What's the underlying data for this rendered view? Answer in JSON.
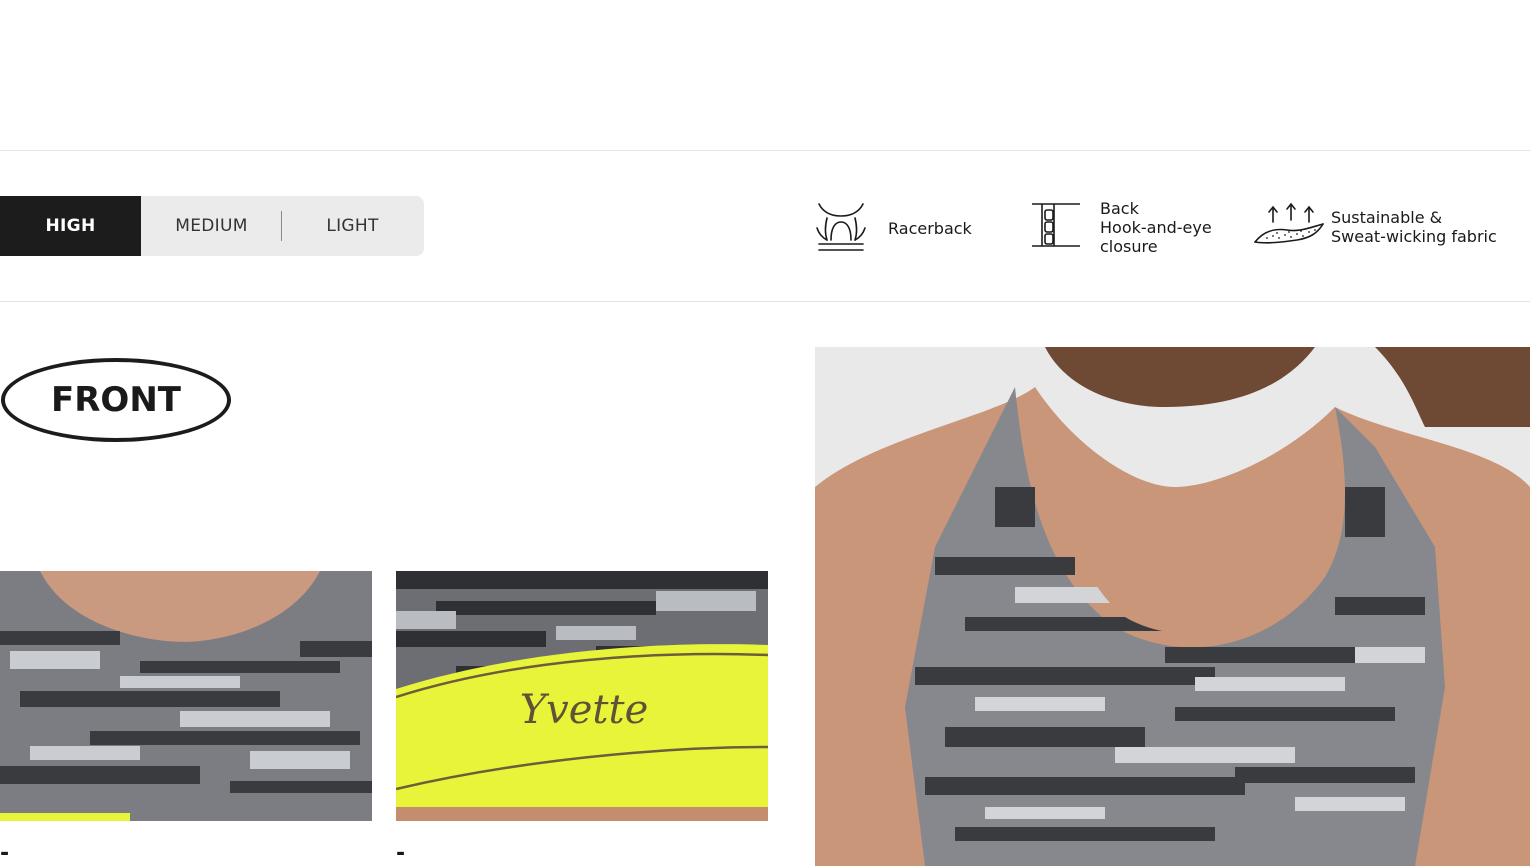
{
  "support_levels": {
    "options": [
      "HIGH",
      "MEDIUM",
      "LIGHT"
    ],
    "selected": "HIGH"
  },
  "features": [
    {
      "icon": "racerback-icon",
      "lines": [
        "Racerback"
      ]
    },
    {
      "icon": "hook-and-eye-icon",
      "lines": [
        "Back",
        "Hook-and-eye",
        "closure"
      ]
    },
    {
      "icon": "sweat-wicking-fabric-icon",
      "lines": [
        "Sustainable &",
        "Sweat-wicking fabric"
      ]
    }
  ],
  "view_badge": "FRONT",
  "gallery": {
    "captions": [
      "-",
      "-"
    ],
    "brand_band_text": "Yvette",
    "band_color": "#e8f43a"
  },
  "colors": {
    "active_bg": "#1c1c1c",
    "control_bg": "#ebebeb",
    "divider": "#e3e3e3"
  }
}
